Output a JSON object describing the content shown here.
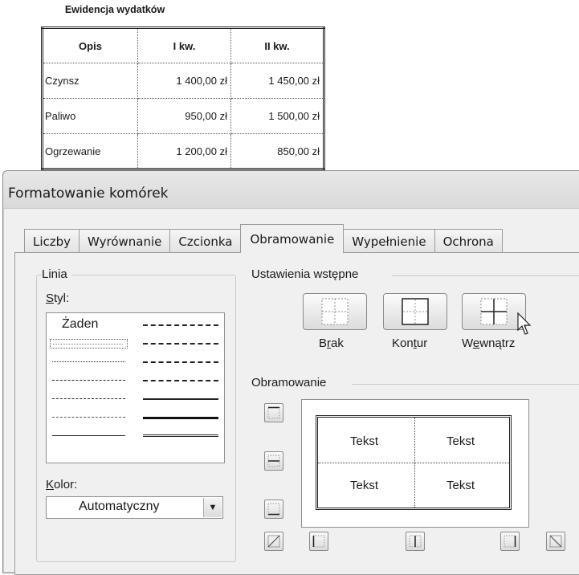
{
  "sheet": {
    "title": "Ewidencja wydatków",
    "headers": [
      "Opis",
      "I kw.",
      "II kw."
    ],
    "rows": [
      [
        "Czynsz",
        "1 400,00 zł",
        "1 450,00 zł"
      ],
      [
        "Paliwo",
        "950,00 zł",
        "1 500,00 zł"
      ],
      [
        "Ogrzewanie",
        "1 200,00 zł",
        "850,00 zł"
      ]
    ]
  },
  "dialog": {
    "title": "Formatowanie komórek",
    "tabs": [
      "Liczby",
      "Wyrównanie",
      "Czcionka",
      "Obramowanie",
      "Wypełnienie",
      "Ochrona"
    ],
    "active_tab": "Obramowanie",
    "line": {
      "group_label": "Linia",
      "style_label": "Styl:",
      "style_none": "Żaden",
      "color_label": "Kolor:",
      "color_value": "Automatyczny"
    },
    "presets": {
      "group_label": "Ustawienia wstępne",
      "items": [
        "Brak",
        "Kontur",
        "Wewnątrz"
      ]
    },
    "border": {
      "group_label": "Obramowanie",
      "preview_text": [
        "Tekst",
        "Tekst",
        "Tekst",
        "Tekst"
      ]
    }
  },
  "colors": {
    "dialog_bg": "#f0f0f0",
    "border": "#8a8a8a",
    "text": "#1a1a1a"
  }
}
